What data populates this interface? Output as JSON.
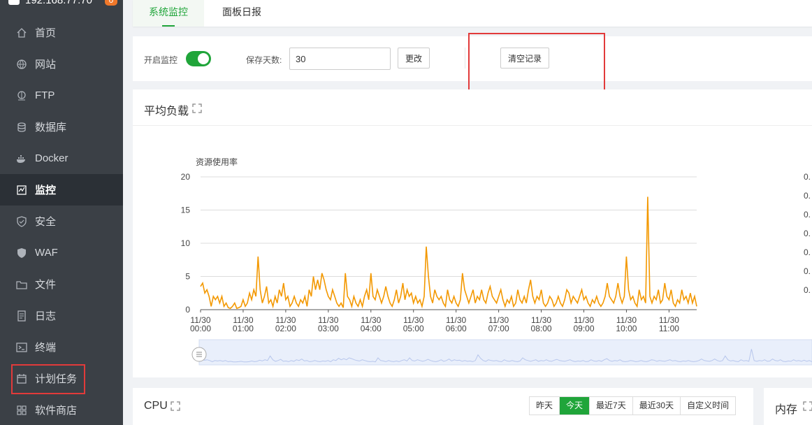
{
  "sidebar": {
    "server_ip": "192.168.77.70",
    "badge_count": "0",
    "items": [
      {
        "label": "首页",
        "icon": "home-icon"
      },
      {
        "label": "网站",
        "icon": "globe-icon"
      },
      {
        "label": "FTP",
        "icon": "ftp-icon"
      },
      {
        "label": "数据库",
        "icon": "database-icon"
      },
      {
        "label": "Docker",
        "icon": "docker-icon"
      },
      {
        "label": "监控",
        "icon": "monitor-icon",
        "active": true
      },
      {
        "label": "安全",
        "icon": "shield-icon"
      },
      {
        "label": "WAF",
        "icon": "waf-shield-icon"
      },
      {
        "label": "文件",
        "icon": "folder-icon"
      },
      {
        "label": "日志",
        "icon": "log-icon"
      },
      {
        "label": "终端",
        "icon": "terminal-icon"
      },
      {
        "label": "计划任务",
        "icon": "calendar-icon"
      },
      {
        "label": "软件商店",
        "icon": "apps-grid-icon"
      }
    ]
  },
  "tabs": [
    {
      "label": "系统监控",
      "active": true
    },
    {
      "label": "面板日报",
      "active": false
    }
  ],
  "controls": {
    "enable_label": "开启监控",
    "enable_on": true,
    "days_label": "保存天数:",
    "days_value": "30",
    "change_label": "更改",
    "clear_label": "清空记录"
  },
  "load_card": {
    "title": "平均负载"
  },
  "cpu_card": {
    "title": "CPU",
    "ranges": [
      {
        "label": "昨天",
        "active": false
      },
      {
        "label": "今天",
        "active": true
      },
      {
        "label": "最近7天",
        "active": false
      },
      {
        "label": "最近30天",
        "active": false
      },
      {
        "label": "自定义时间",
        "active": false
      }
    ]
  },
  "mem_card": {
    "title": "内存"
  },
  "chart_data": {
    "type": "line",
    "ylabel": "资源使用率",
    "ylim": [
      0,
      20
    ],
    "yticks": [
      "0",
      "5",
      "10",
      "15",
      "20"
    ],
    "right_axis_ticks": [
      "0.",
      "0.",
      "0.",
      "0.",
      "0.",
      "0.",
      "0."
    ],
    "xticks": [
      [
        "11/30",
        "00:00"
      ],
      [
        "11/30",
        "01:00"
      ],
      [
        "11/30",
        "02:00"
      ],
      [
        "11/30",
        "03:00"
      ],
      [
        "11/30",
        "04:00"
      ],
      [
        "11/30",
        "05:00"
      ],
      [
        "11/30",
        "06:00"
      ],
      [
        "11/30",
        "07:00"
      ],
      [
        "11/30",
        "08:00"
      ],
      [
        "11/30",
        "09:00"
      ],
      [
        "11/30",
        "10:00"
      ],
      [
        "11/30",
        "11:00"
      ]
    ],
    "x_hours_range": [
      0,
      11.65
    ],
    "line_color": "#f39800",
    "grid": true,
    "series": [
      {
        "values": [
          3.5,
          4,
          2.5,
          3,
          2,
          0.5,
          2,
          1.5,
          2,
          1,
          2,
          0.5,
          1,
          0.3,
          0.2,
          0.5,
          1,
          0.2,
          0.3,
          0.5,
          1.5,
          0.5,
          1,
          2.5,
          1.5,
          3,
          2,
          8,
          3,
          1,
          2,
          3.5,
          1,
          1.5,
          0.5,
          2,
          1,
          3,
          2,
          4,
          1.5,
          2,
          0.5,
          1,
          2,
          1,
          0.5,
          1.5,
          1,
          2,
          0.5,
          3,
          2,
          5,
          3,
          4.5,
          3,
          5.5,
          4.5,
          3,
          2,
          1.5,
          3,
          2,
          1,
          0.5,
          1,
          0.3,
          5.5,
          2,
          1.5,
          0.5,
          2,
          1,
          0.5,
          1.5,
          0.5,
          2,
          3,
          1.5,
          5.5,
          2,
          1.5,
          3,
          2,
          1,
          2,
          3.5,
          2,
          1,
          0.5,
          1.5,
          3,
          1,
          2,
          4,
          1.5,
          3,
          2,
          2.5,
          1,
          2,
          1,
          1.5,
          0.5,
          2,
          9.5,
          5,
          2,
          1,
          3,
          2,
          1.5,
          2,
          1,
          0.5,
          3,
          1.5,
          1,
          2,
          1,
          0.5,
          1.5,
          5.5,
          3,
          2,
          1,
          2,
          3,
          1,
          2,
          1.5,
          3,
          1.5,
          1,
          2.5,
          3.5,
          2,
          1.5,
          1,
          2,
          3,
          1.5,
          0.5,
          1.5,
          1,
          2,
          0.5,
          1,
          3,
          1.5,
          1,
          2,
          1,
          3,
          4.5,
          2,
          1,
          2,
          1.5,
          3,
          1,
          0.5,
          1,
          2,
          1.5,
          0.5,
          1,
          2,
          1,
          0.5,
          1.5,
          3,
          2.5,
          1,
          2,
          1.5,
          1,
          2,
          3,
          1.5,
          2,
          1,
          0.5,
          1.5,
          1,
          2,
          1,
          0.5,
          1,
          2,
          4,
          2,
          1.5,
          1,
          2,
          4,
          2,
          1,
          2,
          8,
          3,
          1.5,
          2,
          1,
          0.5,
          3,
          1.5,
          2,
          1,
          17,
          2,
          1,
          2,
          1.5,
          3,
          1,
          1.5,
          4,
          2,
          1.5,
          3,
          1,
          0.5,
          1.5,
          1,
          3,
          1.5,
          2,
          1,
          2.5,
          1,
          2,
          0.5
        ]
      }
    ]
  }
}
